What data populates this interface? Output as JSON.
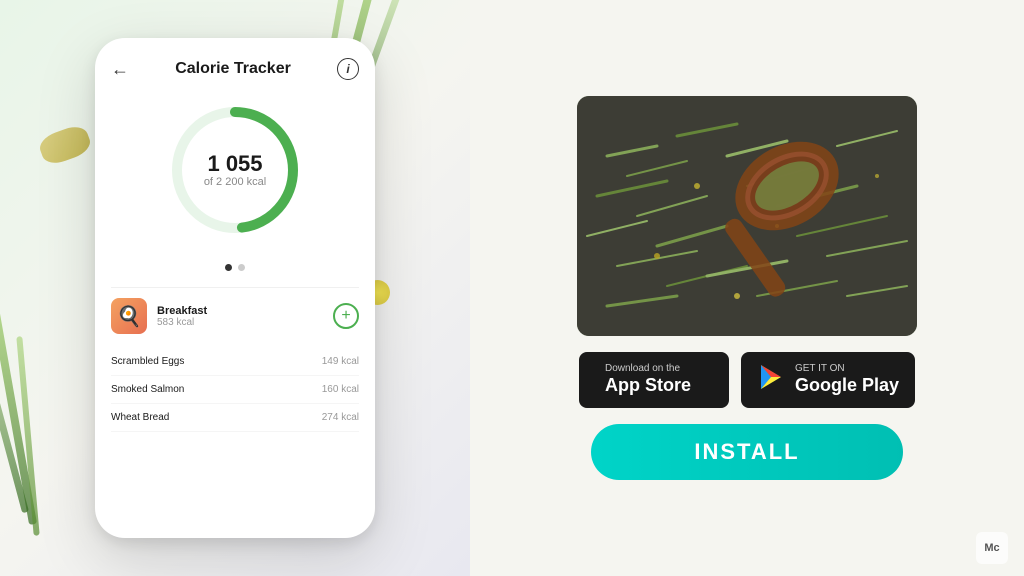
{
  "left": {
    "phone": {
      "header": {
        "back_label": "←",
        "title": "Calorie Tracker",
        "info_label": "i"
      },
      "ring": {
        "calories": "1 055",
        "total_label": "of 2 200 kcal",
        "progress_percent": 48,
        "ring_color": "#4caf50",
        "ring_bg": "#e8f5e9"
      },
      "breakfast": {
        "name": "Breakfast",
        "kcal": "583 kcal",
        "add_icon": "+"
      },
      "food_items": [
        {
          "name": "Scrambled Eggs",
          "kcal": "149 kcal"
        },
        {
          "name": "Smoked Salmon",
          "kcal": "160 kcal"
        },
        {
          "name": "Wheat Bread",
          "kcal": "274 kcal"
        }
      ]
    }
  },
  "right": {
    "app_store_btn": {
      "subtitle": "Download on the",
      "name": "App Store",
      "icon": ""
    },
    "google_play_btn": {
      "subtitle": "GET IT ON",
      "name": "Google Play",
      "icon": "▶"
    },
    "install_label": "INSTALL"
  },
  "watermark": "Mc"
}
